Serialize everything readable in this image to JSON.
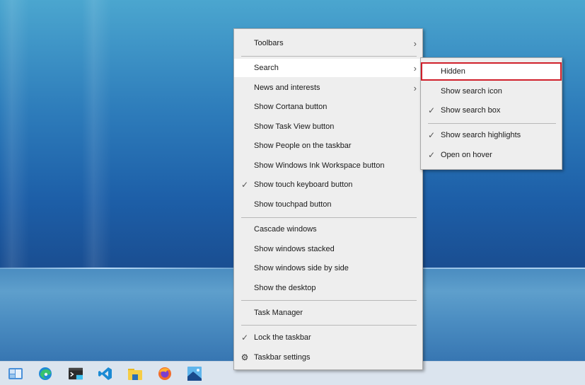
{
  "context_menu": {
    "items": [
      {
        "label": "Toolbars",
        "submenu": true,
        "checked": false
      },
      {
        "label": "Search",
        "submenu": true,
        "checked": false,
        "hovered": true
      },
      {
        "label": "News and interests",
        "submenu": true,
        "checked": false
      },
      {
        "label": "Show Cortana button",
        "checked": false
      },
      {
        "label": "Show Task View button",
        "checked": false
      },
      {
        "label": "Show People on the taskbar",
        "checked": false
      },
      {
        "label": "Show Windows Ink Workspace button",
        "checked": false
      },
      {
        "label": "Show touch keyboard button",
        "checked": true
      },
      {
        "label": "Show touchpad button",
        "checked": false
      },
      {
        "label": "Cascade windows",
        "checked": false
      },
      {
        "label": "Show windows stacked",
        "checked": false
      },
      {
        "label": "Show windows side by side",
        "checked": false
      },
      {
        "label": "Show the desktop",
        "checked": false
      },
      {
        "label": "Task Manager",
        "checked": false
      },
      {
        "label": "Lock the taskbar",
        "checked": true
      },
      {
        "label": "Taskbar settings",
        "icon": "gear-icon"
      }
    ],
    "check_glyph": "✓",
    "arrow_glyph": "›",
    "gear_glyph": "⚙"
  },
  "search_submenu": {
    "items": [
      {
        "label": "Hidden",
        "checked": false,
        "highlighted": true
      },
      {
        "label": "Show search icon",
        "checked": false
      },
      {
        "label": "Show search box",
        "checked": true
      },
      {
        "label": "Show search highlights",
        "checked": true
      },
      {
        "label": "Open on hover",
        "checked": true
      }
    ],
    "highlight_color": "#d0202b"
  },
  "taskbar": {
    "apps": [
      {
        "name": "widgets",
        "icon": "widgets-icon"
      },
      {
        "name": "Microsoft Edge",
        "icon": "edge-icon"
      },
      {
        "name": "Terminal",
        "icon": "terminal-icon"
      },
      {
        "name": "Visual Studio Code",
        "icon": "vscode-icon"
      },
      {
        "name": "File Explorer",
        "icon": "file-explorer-icon"
      },
      {
        "name": "Firefox",
        "icon": "firefox-icon"
      },
      {
        "name": "Photos",
        "icon": "photos-icon"
      }
    ]
  }
}
